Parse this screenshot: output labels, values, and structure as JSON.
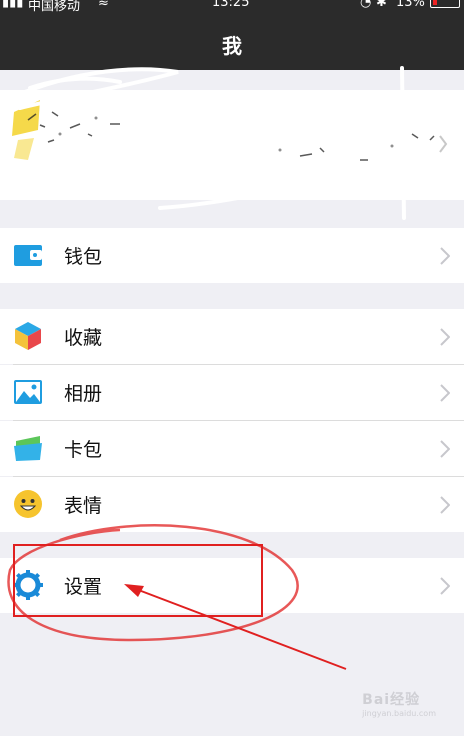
{
  "status": {
    "carrier": "中国移动",
    "time": "13:25",
    "battery": "13%",
    "wifi_icon": "wifi-icon",
    "bluetooth_icon": "bluetooth-icon"
  },
  "nav": {
    "title": "我"
  },
  "menu": {
    "wallet": "钱包",
    "favorites": "收藏",
    "album": "相册",
    "cards": "卡包",
    "stickers": "表情",
    "settings": "设置"
  },
  "watermark": {
    "brand": "Bai经验",
    "url": "jingyan.baidu.com"
  },
  "colors": {
    "navbar": "#2b2b2b",
    "background": "#efeff4",
    "annotation_red": "#e02020",
    "settings_icon": "#1a8ad8"
  }
}
